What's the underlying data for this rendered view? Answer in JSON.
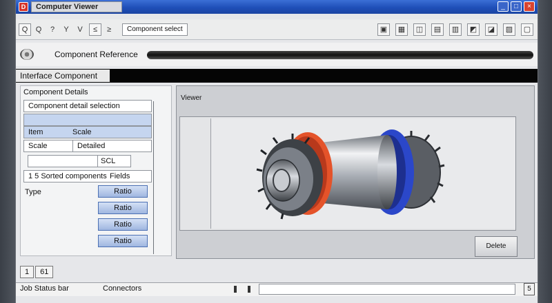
{
  "window": {
    "title": "Computer Viewer",
    "icon_label": "D",
    "buttons": [
      "_",
      "□",
      "×"
    ]
  },
  "toolbar": {
    "icons_left": [
      "Q",
      "Q",
      "?",
      "Y",
      "V",
      "≤",
      "≥"
    ],
    "field_label": "Component select",
    "icons_right": [
      "▣",
      "▦",
      "◫",
      "▤",
      "▥",
      "◩",
      "◪",
      "▨",
      "▢"
    ]
  },
  "address": {
    "label": "Component Reference"
  },
  "section": {
    "title": "Interface Component"
  },
  "left_panel": {
    "heading": "Component Details",
    "rows": [
      {
        "label": "Component detail selection",
        "style": "white"
      },
      {
        "label": "",
        "style": "blue"
      },
      {
        "label": "Item",
        "value": "Scale",
        "style": "blue"
      },
      {
        "label": "Scale",
        "value": "Detailed",
        "style": "white"
      }
    ],
    "group": {
      "label": "SCL",
      "selected": "SCL"
    },
    "group_row": {
      "label": "1 5  Sorted components",
      "value": "Fields"
    },
    "type_label": "Type",
    "buttons": [
      "Ratio",
      "Ratio",
      "Ratio",
      "Ratio"
    ]
  },
  "viewer": {
    "label": "Viewer",
    "button_label": "Delete",
    "part": {
      "name": "gear-shaft-component",
      "accent_colors": {
        "red": "#e4532a",
        "blue": "#2b47c9",
        "steel": "#b9bdc3"
      }
    }
  },
  "status": {
    "cell_1": "1",
    "cell_2": "61",
    "left_text": "Job Status bar",
    "mid_text": "Connectors",
    "end_label": "5"
  }
}
